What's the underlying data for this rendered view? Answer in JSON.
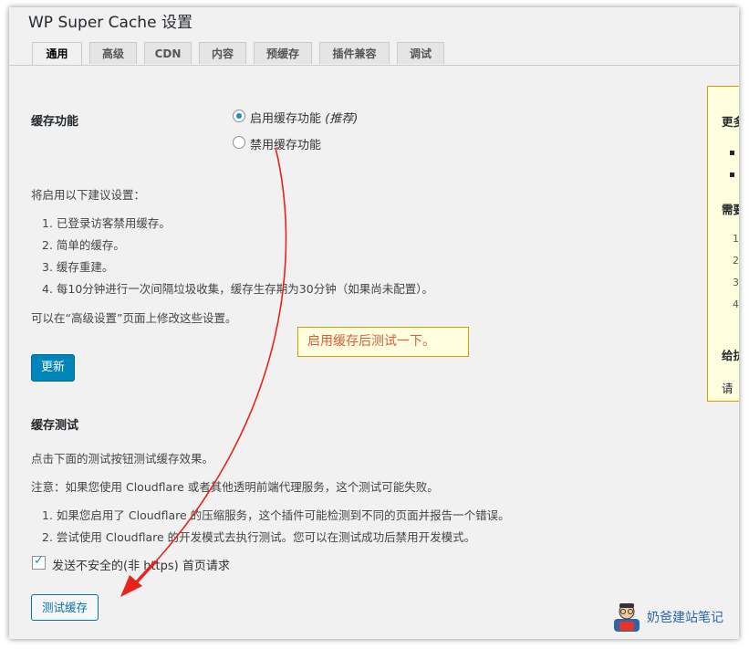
{
  "window": {
    "title": "WP Super Cache 设置"
  },
  "tabs": [
    {
      "label": "通用",
      "active": true
    },
    {
      "label": "高级"
    },
    {
      "label": "CDN"
    },
    {
      "label": "内容"
    },
    {
      "label": "预缓存"
    },
    {
      "label": "插件兼容"
    },
    {
      "label": "调试"
    }
  ],
  "caching": {
    "label": "缓存功能",
    "option_on": "启用缓存功能",
    "option_on_note": "(推荐)",
    "option_off": "禁用缓存功能",
    "selected": "on"
  },
  "recommend": {
    "intro": "将启用以下建议设置：",
    "items": [
      "1. 已登录访客禁用缓存。",
      "2. 简单的缓存。",
      "3. 缓存重建。",
      "4. 每10分钟进行一次间隔垃圾收集，缓存生存期为30分钟（如果尚未配置）。"
    ],
    "note": "可以在“高级设置”页面上修改这些设置。"
  },
  "update_button": "更新",
  "annotation": {
    "text": "启用缓存后测试一下。",
    "color": "#e05a3a"
  },
  "cache_test": {
    "label": "缓存测试",
    "desc": "点击下面的测试按钮测试缓存效果。",
    "warning": "注意：如果您使用 Cloudflare 或者其他透明前端代理服务，这个测试可能失败。",
    "items": [
      "1. 如果您启用了 Cloudflare 的压缩服务，这个插件可能检测到不同的页面并报告一个错误。",
      "2. 尝试使用 Cloudflare 的开发模式去执行测试。您可以在测试成功后禁用开发模式。"
    ],
    "checkbox_label": "发送不安全的(非 https) 首页请求",
    "checkbox_checked": true,
    "test_button": "测试缓存"
  },
  "sidebar": {
    "heading_1": "更多",
    "heading_2": "需要",
    "numbers": [
      "1",
      "2",
      "3",
      "4"
    ],
    "heading_3": "给抗",
    "footer": "请"
  },
  "watermark": {
    "text": "奶爸建站笔记",
    "icon": "mascot-icon"
  },
  "colors": {
    "primary": "#0085ba",
    "accent_arrow": "#e8231a",
    "note_bg": "#ffffe0"
  }
}
